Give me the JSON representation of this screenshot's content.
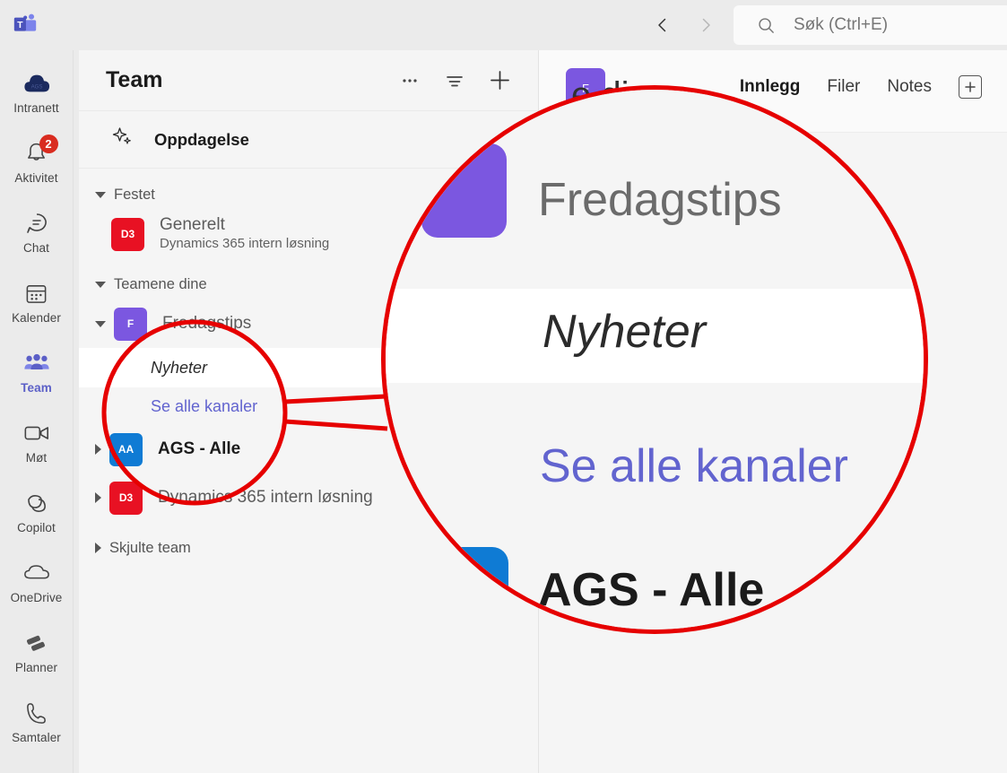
{
  "titlebar": {
    "logo_icon": "microsoft-teams-logo",
    "back_icon": "chevron-left-icon",
    "forward_icon": "chevron-right-icon",
    "search_icon": "search-icon",
    "search_placeholder": "Søk (Ctrl+E)",
    "search_value": ""
  },
  "rail": {
    "items": [
      {
        "label": "Intranett",
        "icon": "cloud-ags-icon",
        "active": false,
        "badge": ""
      },
      {
        "label": "Aktivitet",
        "icon": "bell-icon",
        "active": false,
        "badge": "2"
      },
      {
        "label": "Chat",
        "icon": "chat-bubble-icon",
        "active": false,
        "badge": ""
      },
      {
        "label": "Kalender",
        "icon": "calendar-icon",
        "active": false,
        "badge": ""
      },
      {
        "label": "Team",
        "icon": "people-icon",
        "active": true,
        "badge": ""
      },
      {
        "label": "Møt",
        "icon": "video-camera-icon",
        "active": false,
        "badge": ""
      },
      {
        "label": "Copilot",
        "icon": "copilot-icon",
        "active": false,
        "badge": ""
      },
      {
        "label": "OneDrive",
        "icon": "cloud-icon",
        "active": false,
        "badge": ""
      },
      {
        "label": "Planner",
        "icon": "planner-icon",
        "active": false,
        "badge": ""
      },
      {
        "label": "Samtaler",
        "icon": "phone-icon",
        "active": false,
        "badge": ""
      }
    ]
  },
  "panel": {
    "title": "Team",
    "more_icon": "ellipsis-icon",
    "filter_icon": "filter-icon",
    "add_icon": "plus-icon",
    "discover": {
      "label": "Oppdagelse",
      "icon": "sparkle-icon"
    },
    "pinned_group": {
      "label": "Festet",
      "expanded": true
    },
    "pinned_items": [
      {
        "name": "Generelt",
        "sub": "Dynamics 365 intern løsning",
        "initials": "D3",
        "color": "#e81123"
      }
    ],
    "your_teams_group": {
      "label": "Teamene dine",
      "expanded": true
    },
    "teams": [
      {
        "name": "Fredagstips",
        "initials": "F",
        "color": "#7b57e0",
        "expanded": true,
        "bold": false,
        "channels": [
          {
            "name": "Nyheter",
            "selected": true
          }
        ],
        "see_all": "Se alle kanaler"
      },
      {
        "name": "AGS - Alle",
        "initials": "AA",
        "color": "#0f7bd4",
        "expanded": false,
        "bold": true,
        "channels": [],
        "see_all": ""
      },
      {
        "name": "Dynamics 365 intern løsning",
        "initials": "D3",
        "color": "#e81123",
        "expanded": false,
        "bold": false,
        "channels": [],
        "see_all": ""
      }
    ],
    "hidden_group": {
      "label": "Skjulte team",
      "expanded": false
    }
  },
  "content": {
    "channel_avatar_initials": "F",
    "channel_avatar_color": "#7b57e0",
    "channel_title": "e dine",
    "tabs": [
      {
        "label": "Innlegg",
        "active": true
      },
      {
        "label": "Filer",
        "active": false
      },
      {
        "label": "Notes",
        "active": false
      }
    ],
    "add_tab_icon": "plus-box-icon"
  },
  "annotation": {
    "color": "#e60000",
    "magnified_rows": [
      {
        "text": "Fredagstips",
        "style": "normal",
        "color": "#6b6b6b",
        "avatar": "#7b57e0"
      },
      {
        "text": "Nyheter",
        "style": "italic",
        "color": "#2b2b2b",
        "avatar": ""
      },
      {
        "text": "Se alle kanaler",
        "style": "normal",
        "color": "#6264cf",
        "avatar": ""
      },
      {
        "text": "AGS - Alle",
        "style": "bold",
        "color": "#1b1b1b",
        "avatar": "#0f7bd4"
      }
    ]
  }
}
